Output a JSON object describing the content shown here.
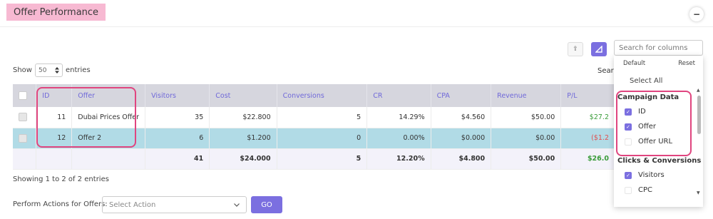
{
  "header": {
    "title": "Offer Performance",
    "collapse_icon": "−"
  },
  "toolbar": {
    "export_icon": "⇪"
  },
  "length": {
    "show_label": "Show",
    "value": "50",
    "entries_label": "entries"
  },
  "search": {
    "label": "Search"
  },
  "table": {
    "columns": [
      "ID",
      "Offer",
      "Visitors",
      "Cost",
      "Conversions",
      "CR",
      "CPA",
      "Revenue",
      "P/L"
    ],
    "rows": [
      {
        "id": "11",
        "offer": "Dubai Prices Offer",
        "visitors": "35",
        "cost": "$22.800",
        "conversions": "5",
        "cr": "14.29%",
        "cpa": "$4.560",
        "revenue": "$50.00",
        "pl": "$27.2"
      },
      {
        "id": "12",
        "offer": "Offer 2",
        "visitors": "6",
        "cost": "$1.200",
        "conversions": "0",
        "cr": "0.00%",
        "cpa": "$0.000",
        "revenue": "$0.00",
        "pl": "($1.2"
      }
    ],
    "totals": {
      "visitors": "41",
      "cost": "$24.000",
      "conversions": "5",
      "cr": "12.20%",
      "cpa": "$4.800",
      "revenue": "$50.00",
      "pl": "$26.0"
    }
  },
  "footer": {
    "info": "Showing 1 to 2 of 2 entries",
    "actions_label": "Perform Actions for Offers:",
    "action_placeholder": "Select Action",
    "go_label": "GO"
  },
  "column_panel": {
    "search_placeholder": "Search for columns",
    "default_label": "Default",
    "reset_label": "Reset",
    "select_all": "Select All",
    "groups": [
      {
        "name": "Campaign Data",
        "options": [
          {
            "label": "ID",
            "checked": true
          },
          {
            "label": "Offer",
            "checked": true
          },
          {
            "label": "Offer URL",
            "checked": false
          }
        ]
      },
      {
        "name": "Clicks & Conversions",
        "options": [
          {
            "label": "Visitors",
            "checked": true
          },
          {
            "label": "CPC",
            "checked": false
          }
        ]
      }
    ]
  },
  "colors": {
    "accent": "#7b6fe0",
    "title_bg": "#f7b9d2",
    "highlight_border": "#e0457f",
    "selected_row": "#b1dbe6",
    "positive": "#3a9c3a",
    "negative": "#e05050"
  }
}
